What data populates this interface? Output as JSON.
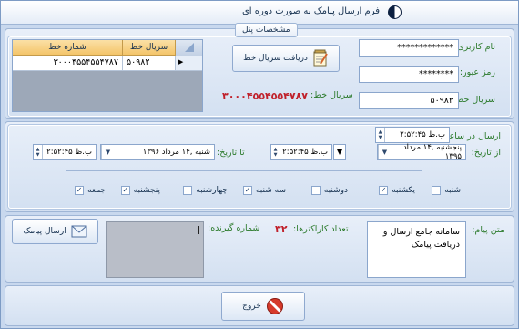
{
  "window": {
    "title": "فرم ارسال پیامک به صورت دوره ای"
  },
  "panel_settings": {
    "caption": "مشخصات پنل",
    "username_label": "نام کاربری:",
    "username_value": "*************",
    "password_label": "رمز عبور:",
    "password_value": "********",
    "line_label": "سریال خط:",
    "line_value": "۵۰۹۸۲",
    "get_serial_button": "دریافت سریال خط",
    "serial_label": "سریال خط:",
    "serial_value": "۳۰۰۰۴۵۵۴۵۵۴۷۸۷"
  },
  "grid": {
    "columns": [
      "شماره خط",
      "سریال خط"
    ],
    "rows": [
      {
        "line_number": "۳۰۰۰۴۵۵۴۵۵۴۷۸۷",
        "serial": "۵۰۹۸۲"
      }
    ]
  },
  "schedule": {
    "send_time_label": "ارسال در ساعت:",
    "send_time_value": "ب.ظ ۲:۵۲:۴۵",
    "from_date_label": "از تاریخ:",
    "from_date_value": "پنجشنبه ,۱۴  مرداد  ۱۳۹۵",
    "from_time_value": "ب.ظ ۲:۵۲:۴۵",
    "to_date_label": "تا تاریخ:",
    "to_date_value": "شنبه ,۱۴  مرداد  ۱۳۹۶",
    "to_time_value": "ب.ظ ۲:۵۲:۴۵",
    "days": [
      {
        "label": "شنبه",
        "checked": false
      },
      {
        "label": "یکشنبه",
        "checked": true
      },
      {
        "label": "دوشنبه",
        "checked": false
      },
      {
        "label": "سه شنبه",
        "checked": true
      },
      {
        "label": "چهارشنبه",
        "checked": false
      },
      {
        "label": "پنجشنبه",
        "checked": true
      },
      {
        "label": "جمعه",
        "checked": false
      }
    ]
  },
  "message": {
    "text_label": "متن پیام:",
    "text_value": "سامانه جامع ارسال و دریافت پیامک",
    "char_count_label": "تعداد کاراکترها:",
    "char_count_value": "۳۲",
    "recipients_label": "شماره گیرنده:",
    "send_button": "ارسال پیامک"
  },
  "footer": {
    "exit_button": "خروج"
  },
  "colors": {
    "accent": "#c0202a",
    "label_green": "#2b7a2b",
    "panel": "#d3e0f1",
    "grid_header": "#f4c56a"
  }
}
